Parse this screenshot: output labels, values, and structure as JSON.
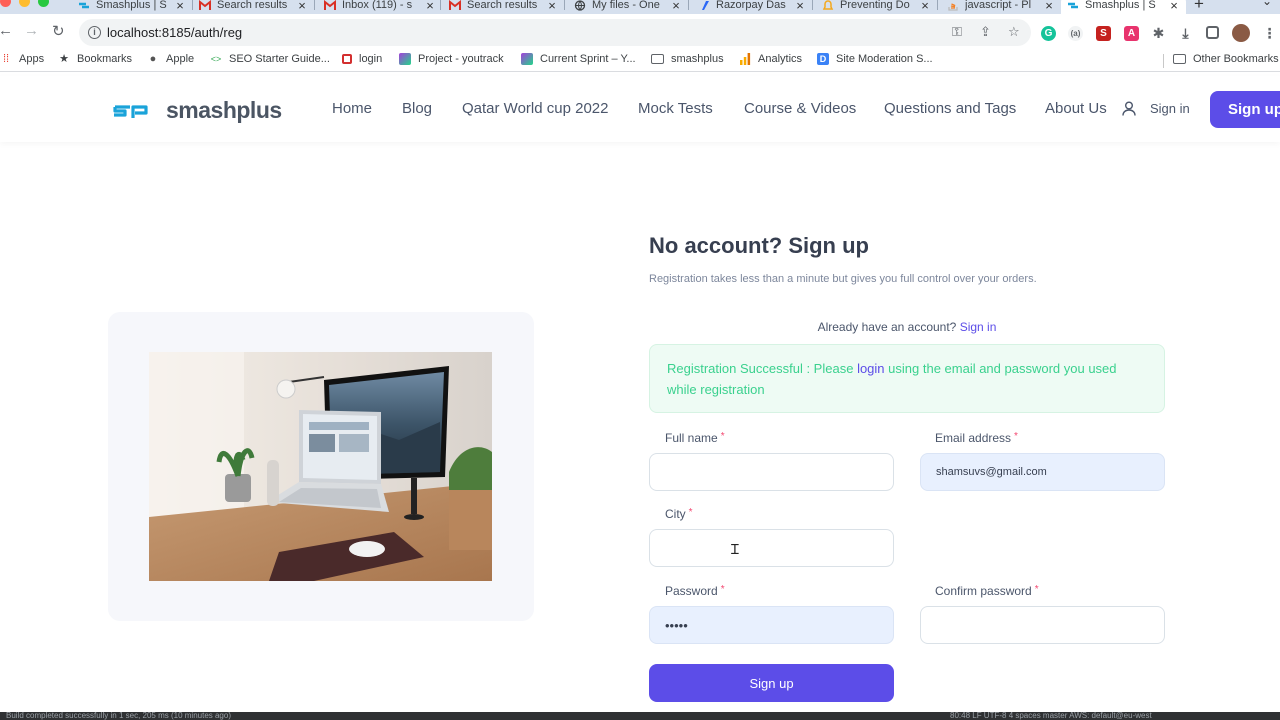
{
  "browser": {
    "tabs": [
      {
        "label": "Smashplus | S",
        "favicon": "smashplus-icon",
        "color": "#1aa3d9"
      },
      {
        "label": "Search results",
        "favicon": "gmail-icon",
        "color": "#d93025"
      },
      {
        "label": "Inbox (119) - s",
        "favicon": "gmail-icon",
        "color": "#d93025"
      },
      {
        "label": "Search results",
        "favicon": "gmail-icon",
        "color": "#d93025"
      },
      {
        "label": "My files - One",
        "favicon": "globe-icon",
        "color": "#3c4043"
      },
      {
        "label": "Razorpay Das",
        "favicon": "razorpay-icon",
        "color": "#2b67f6"
      },
      {
        "label": "Preventing Do",
        "favicon": "bell-icon",
        "color": "#f4a81d"
      },
      {
        "label": "javascript - Pl",
        "favicon": "stackoverflow-icon",
        "color": "#f48024"
      },
      {
        "label": "Smashplus | S",
        "favicon": "smashplus-icon",
        "color": "#1aa3d9",
        "active": true
      }
    ],
    "url": "localhost:8185/auth/reg",
    "bookmarks": [
      {
        "label": "Apps",
        "icon": "apps-grid-icon"
      },
      {
        "label": "Bookmarks",
        "icon": "star-icon"
      },
      {
        "label": "Apple",
        "icon": "apple-icon"
      },
      {
        "label": "SEO Starter Guide...",
        "icon": "code-icon"
      },
      {
        "label": "login",
        "icon": "login-icon"
      },
      {
        "label": "Project - youtrack",
        "icon": "youtrack-icon"
      },
      {
        "label": "Current Sprint – Y...",
        "icon": "youtrack-icon"
      },
      {
        "label": "smashplus",
        "icon": "folder-icon"
      },
      {
        "label": "Analytics",
        "icon": "analytics-icon"
      },
      {
        "label": "Site Moderation S...",
        "icon": "d-icon"
      },
      {
        "label": "Other Bookmarks",
        "icon": "folder-icon"
      }
    ]
  },
  "site": {
    "logo_text": "smashplus",
    "nav": [
      "Home",
      "Blog",
      "Qatar World cup 2022",
      "Mock Tests",
      "Course & Videos",
      "Questions and Tags",
      "About Us"
    ],
    "signin_label": "Sign in",
    "signup_label": "Sign up"
  },
  "form": {
    "title": "No account? Sign up",
    "subtitle": "Registration takes less than a minute but gives you full control over your orders.",
    "already_text": "Already have an account?",
    "already_link": "Sign in",
    "alert_before": "Registration Successful : Please",
    "alert_link": "login",
    "alert_after": "using the email and password you used while registration",
    "required_mark": "*",
    "fields": {
      "full_name": {
        "label": "Full name",
        "value": ""
      },
      "email": {
        "label": "Email address",
        "value": "shamsuvs@gmail.com"
      },
      "city": {
        "label": "City",
        "value": ""
      },
      "password": {
        "label": "Password",
        "value": "•••••"
      },
      "confirm_password": {
        "label": "Confirm password",
        "value": ""
      }
    },
    "submit_label": "Sign up"
  },
  "statusbar": {
    "left": "Build completed successfully in 1 sec, 205 ms (10 minutes ago)",
    "right": "80:48   LF   UTF-8   4 spaces   master   AWS: default@eu-west"
  },
  "colors": {
    "brand": "#5c4de8",
    "success_text": "#3ad18e",
    "required": "#f34770"
  }
}
